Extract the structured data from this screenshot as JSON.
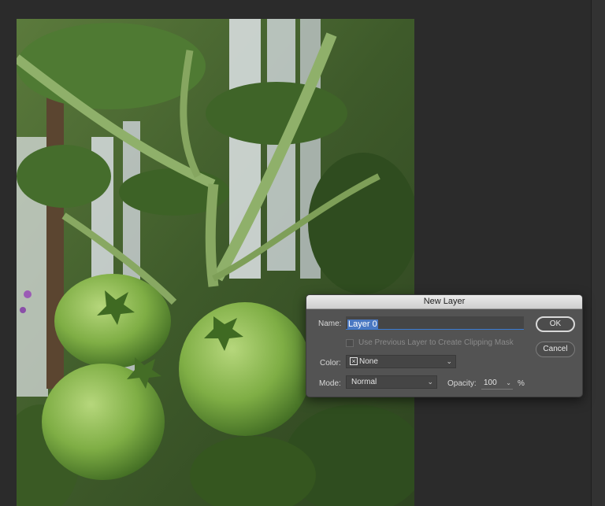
{
  "dialog": {
    "title": "New Layer",
    "name_label": "Name:",
    "name_value": "Layer 0",
    "clipping_label": "Use Previous Layer to Create Clipping Mask",
    "clipping_checked": false,
    "color_label": "Color:",
    "color_value": "None",
    "mode_label": "Mode:",
    "mode_value": "Normal",
    "opacity_label": "Opacity:",
    "opacity_value": "100",
    "opacity_unit": "%",
    "ok_label": "OK",
    "cancel_label": "Cancel"
  },
  "colors": {
    "canvas_bg": "#2b2b2b",
    "dialog_bg": "#535353",
    "accent": "#3a7bd5",
    "selection": "#4a78c2"
  },
  "canvas": {
    "image_subject": "green tomatoes on vine"
  }
}
